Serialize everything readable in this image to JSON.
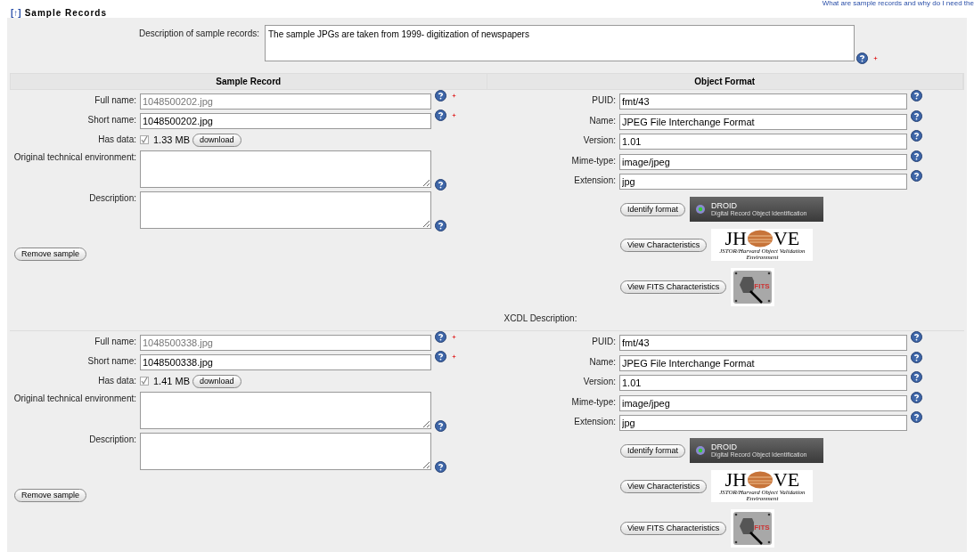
{
  "top_link": "What are sample records and why do I need the",
  "section": {
    "toggle": "[↑]",
    "title": "Sample Records"
  },
  "description": {
    "label": "Description of sample records:",
    "value": "The sample JPGs are taken from 1999- digitization of newspapers",
    "required": true
  },
  "columns": [
    "Sample Record",
    "Object Format"
  ],
  "records": [
    {
      "fields": [
        {
          "kind": "input",
          "label": "Full name:",
          "value": "1048500202.jpg",
          "disabled": true,
          "required": true
        },
        {
          "kind": "input",
          "label": "Short name:",
          "value": "1048500202.jpg",
          "disabled": false,
          "required": true
        },
        {
          "kind": "data",
          "label": "Has data:",
          "checked": true,
          "size": "1.33 MB",
          "button": "download"
        },
        {
          "kind": "textarea",
          "label": "Original technical environment:"
        },
        {
          "kind": "textarea",
          "label": "Description:"
        }
      ],
      "remove": "Remove sample",
      "format": [
        {
          "label": "PUID:",
          "value": "fmt/43"
        },
        {
          "label": "Name:",
          "value": "JPEG File Interchange Format"
        },
        {
          "label": "Version:",
          "value": "1.01"
        },
        {
          "label": "Mime-type:",
          "value": "image/jpeg"
        },
        {
          "label": "Extension:",
          "value": "jpg"
        }
      ],
      "tools": [
        {
          "kind": "droid",
          "button": "Identify format",
          "logo_title": "DROID",
          "logo_subtitle": "Digital Record Object Identification"
        },
        {
          "kind": "jhove",
          "button": "View Characteristics",
          "logo_left": "JH",
          "logo_right": "VE",
          "logo_subtitle": "JSTOR/Harvard Object Validation Environment"
        },
        {
          "kind": "fits",
          "button": "View FITS Characteristics",
          "logo_title": "FITS"
        }
      ],
      "xcdl_label": "XCDL Description:"
    },
    {
      "fields": [
        {
          "kind": "input",
          "label": "Full name:",
          "value": "1048500338.jpg",
          "disabled": true,
          "required": true
        },
        {
          "kind": "input",
          "label": "Short name:",
          "value": "1048500338.jpg",
          "disabled": false,
          "required": true
        },
        {
          "kind": "data",
          "label": "Has data:",
          "checked": true,
          "size": "1.41 MB",
          "button": "download"
        },
        {
          "kind": "textarea",
          "label": "Original technical environment:"
        },
        {
          "kind": "textarea",
          "label": "Description:"
        }
      ],
      "remove": "Remove sample",
      "format": [
        {
          "label": "PUID:",
          "value": "fmt/43"
        },
        {
          "label": "Name:",
          "value": "JPEG File Interchange Format"
        },
        {
          "label": "Version:",
          "value": "1.01"
        },
        {
          "label": "Mime-type:",
          "value": "image/jpeg"
        },
        {
          "label": "Extension:",
          "value": "jpg"
        }
      ],
      "tools": [
        {
          "kind": "droid",
          "button": "Identify format",
          "logo_title": "DROID",
          "logo_subtitle": "Digital Record Object Identification"
        },
        {
          "kind": "jhove",
          "button": "View Characteristics",
          "logo_left": "JH",
          "logo_right": "VE",
          "logo_subtitle": "JSTOR/Harvard Object Validation Environment"
        },
        {
          "kind": "fits",
          "button": "View FITS Characteristics",
          "logo_title": "FITS"
        }
      ]
    }
  ]
}
